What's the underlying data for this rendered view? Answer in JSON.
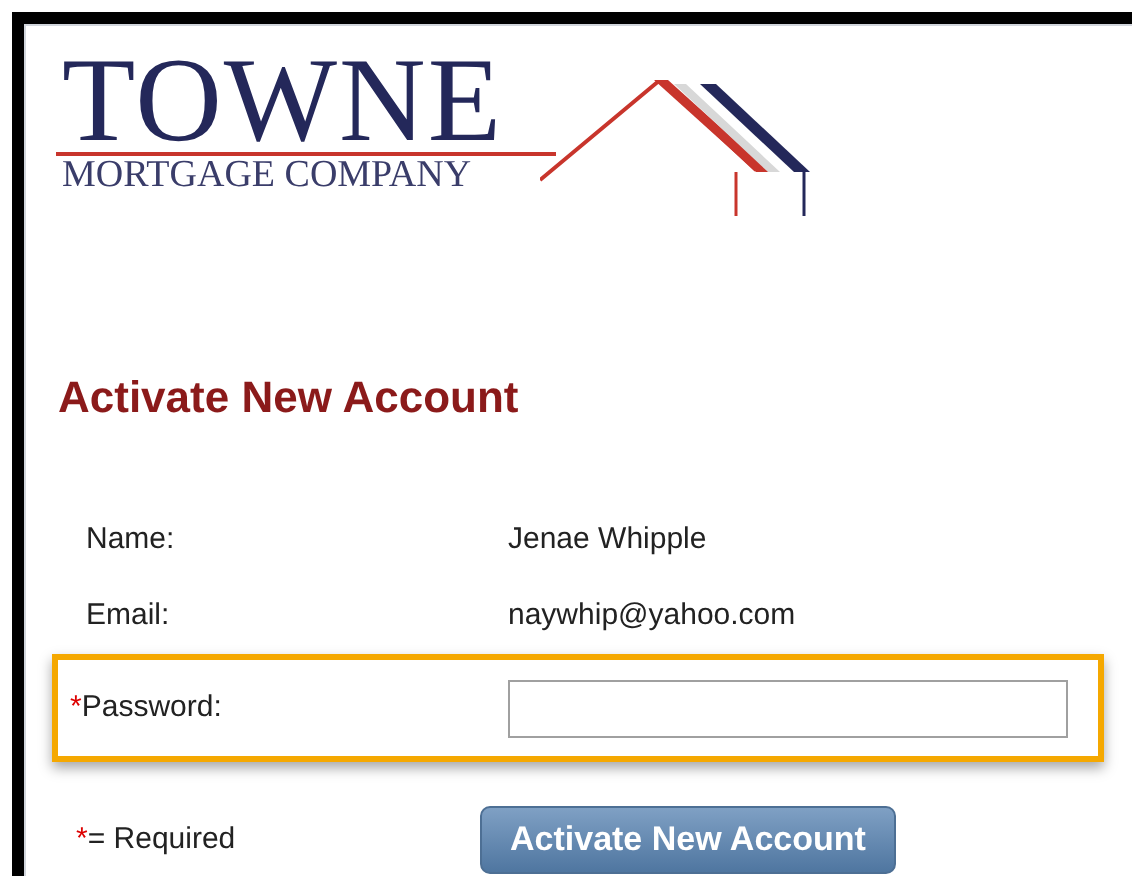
{
  "logo": {
    "wordmark": "TOWNE",
    "tagline": "MORTGAGE COMPANY"
  },
  "heading": "Activate New Account",
  "fields": [
    {
      "kind": "text",
      "label": "Name:",
      "required": false,
      "value": "Jenae Whipple",
      "highlighted": false
    },
    {
      "kind": "text",
      "label": "Email:",
      "required": false,
      "value": "naywhip@yahoo.com",
      "highlighted": false
    },
    {
      "kind": "input",
      "marker": "*",
      "label": "Password:",
      "required": true,
      "highlighted": true
    }
  ],
  "legend": {
    "marker": "*",
    "text": "= Required"
  },
  "submit_button": "Activate New Account"
}
